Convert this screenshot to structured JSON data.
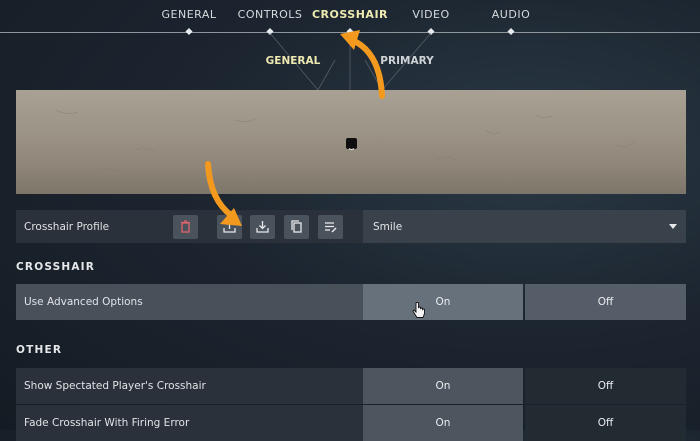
{
  "nav": {
    "tabs": [
      {
        "label": "GENERAL"
      },
      {
        "label": "CONTROLS"
      },
      {
        "label": "CROSSHAIR"
      },
      {
        "label": "VIDEO"
      },
      {
        "label": "AUDIO"
      }
    ],
    "active": "CROSSHAIR"
  },
  "subnav": {
    "general": "GENERAL",
    "primary": "PRIMARY"
  },
  "profile": {
    "label": "Crosshair Profile",
    "actions": [
      "trash-icon",
      "upload-icon",
      "download-icon",
      "copy-icon",
      "rename-icon"
    ],
    "selected": "Smile"
  },
  "sections": {
    "crosshair": "CROSSHAIR",
    "other": "OTHER"
  },
  "options": [
    {
      "label": "Use Advanced Options",
      "on": "On",
      "off": "Off",
      "selected": "On"
    },
    {
      "label": "Show Spectated Player's Crosshair",
      "on": "On",
      "off": "Off",
      "selected": "On"
    },
    {
      "label": "Fade Crosshair With Firing Error",
      "on": "On",
      "off": "Off",
      "selected": "On"
    }
  ],
  "colors": {
    "accent": "#ede9b0",
    "annotation": "#f39a1e",
    "delete": "#e0646e"
  }
}
